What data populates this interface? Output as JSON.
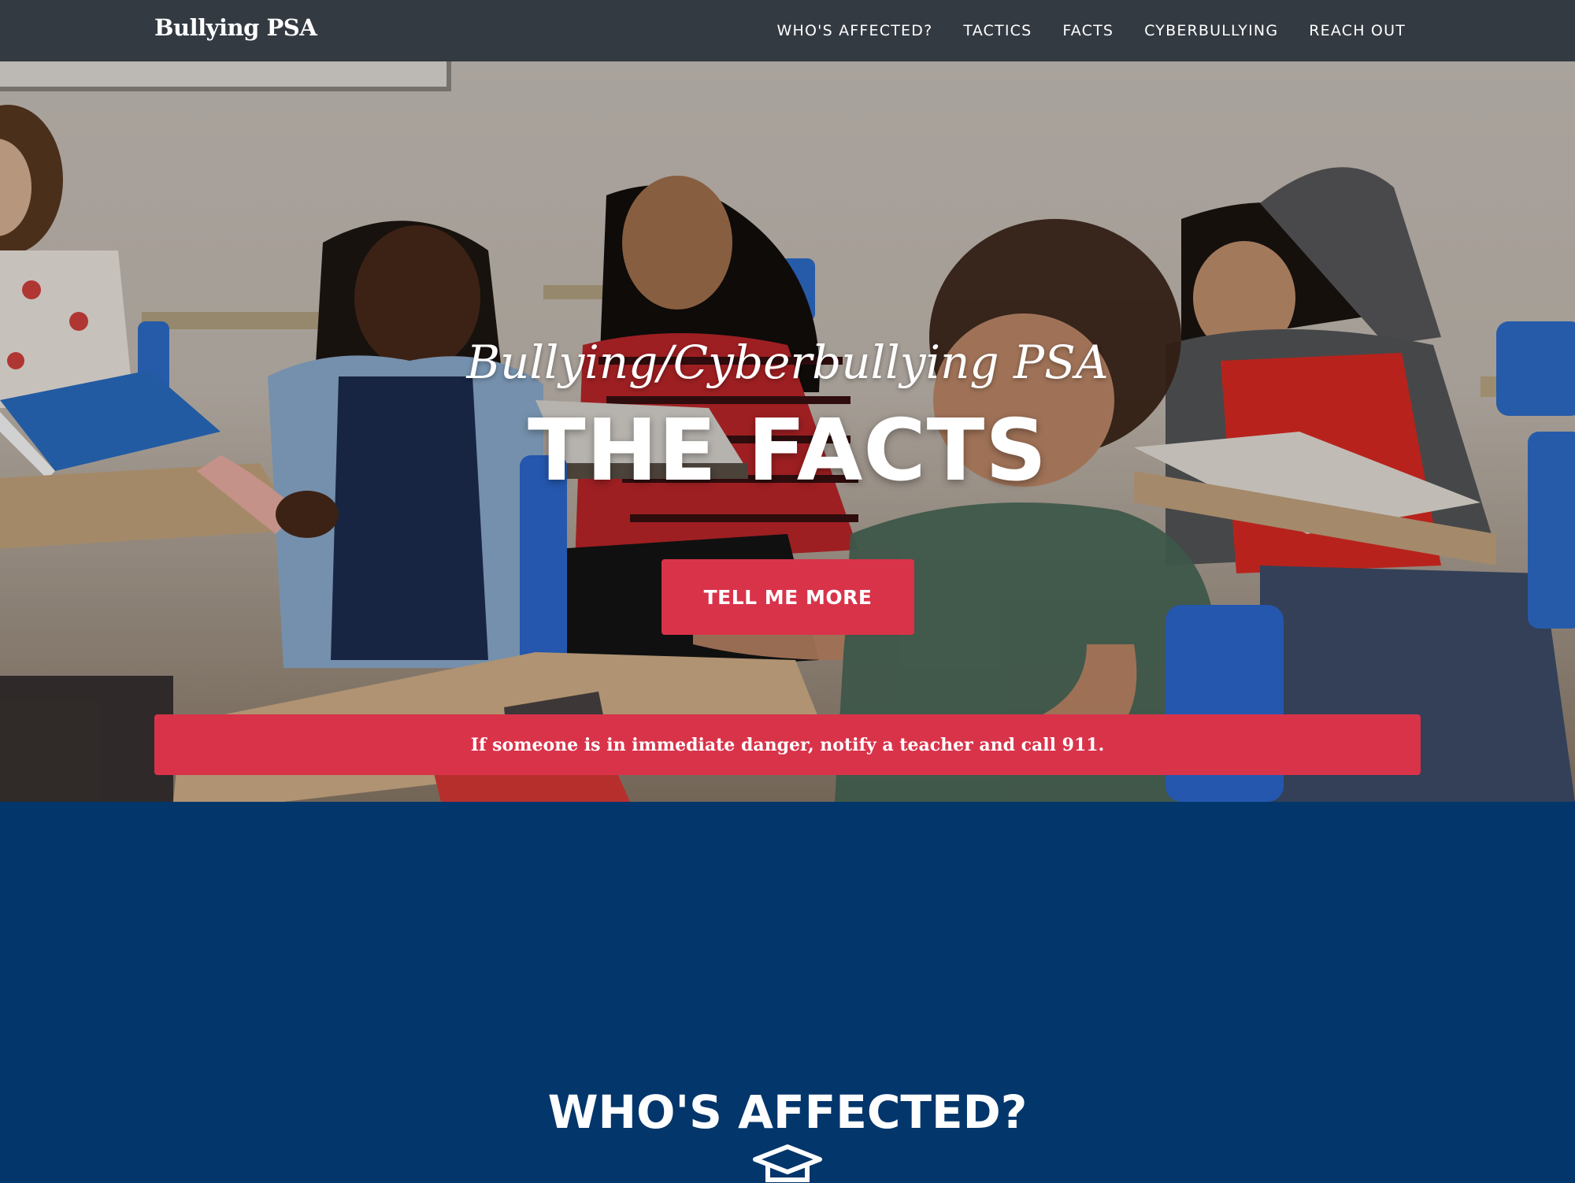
{
  "navbar": {
    "brand": "Bullying PSA",
    "links": [
      {
        "label": "WHO'S AFFECTED?"
      },
      {
        "label": "TACTICS"
      },
      {
        "label": "FACTS"
      },
      {
        "label": "CYBERBULLYING"
      },
      {
        "label": "REACH OUT"
      }
    ]
  },
  "hero": {
    "subheading": "Bullying/Cyberbullying PSA",
    "heading": "THE FACTS",
    "button_label": "TELL ME MORE",
    "alert": "If someone is in immediate danger, notify a teacher and call 911."
  },
  "section": {
    "heading": "WHO'S AFFECTED?",
    "icon": "graduation-cap-icon"
  },
  "colors": {
    "navbar_bg": "#343a42",
    "accent_red": "#d9334a",
    "section_bg": "#03366b",
    "text": "#ffffff"
  }
}
